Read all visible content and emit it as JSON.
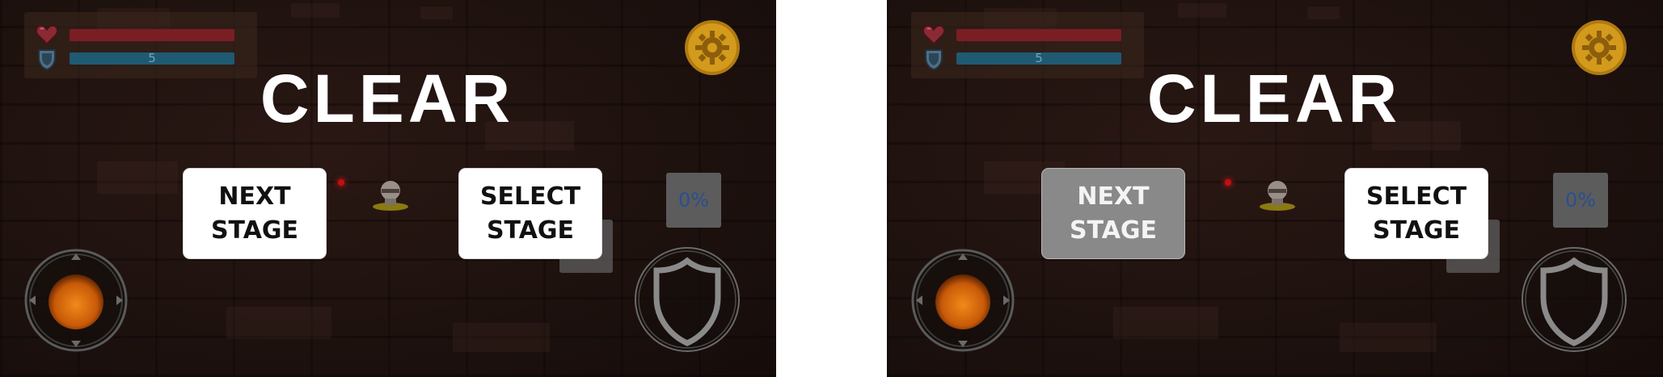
{
  "screens": [
    {
      "state": "",
      "hud": {
        "shield_value": "5"
      },
      "title": "CLEAR",
      "next_button": {
        "line1": "NEXT",
        "line2": "STAGE"
      },
      "select_button": {
        "line1": "SELECT",
        "line2": "STAGE"
      },
      "progress_label": "0%"
    },
    {
      "state": "",
      "hud": {
        "shield_value": "5"
      },
      "title": "CLEAR",
      "next_button": {
        "line1": "NEXT",
        "line2": "STAGE"
      },
      "select_button": {
        "line1": "SELECT",
        "line2": "STAGE"
      },
      "progress_label": "0%"
    }
  ],
  "hp_fill": 1.0,
  "shield_fill": 1.0,
  "colors": {
    "hp_bar": "#7a1e24",
    "shield_bar": "#1f5a73",
    "button_bg": "#ffffff",
    "button_pressed_bg": "#898989",
    "title_text": "#ffffff",
    "coin": "#d49a1c",
    "joystick_orb": "#e07010"
  },
  "icons": [
    "heart-icon",
    "shield-small-icon",
    "gear-coin-icon",
    "player-character-icon",
    "joystick-icon",
    "shield-button-icon"
  ]
}
